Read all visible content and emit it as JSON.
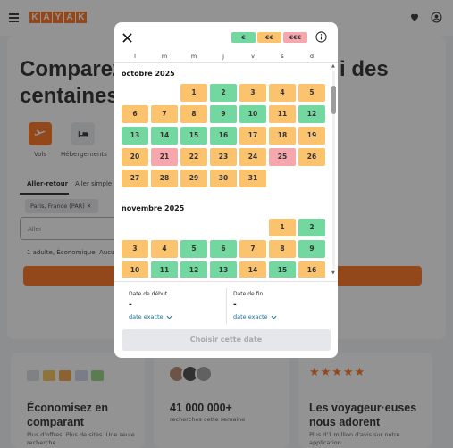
{
  "header": {
    "logo_letters": [
      "K",
      "A",
      "Y",
      "A",
      "K"
    ],
    "icons": [
      "menu-icon",
      "heart-icon",
      "user-icon"
    ]
  },
  "hero": {
    "title_line1": "Comparez",
    "title_line1_right": "i des",
    "title_line2": "centaines",
    "categories": [
      "Vols",
      "Hébergements"
    ],
    "tabs": [
      "Aller-retour",
      "Aller simple"
    ],
    "origin_chip": "Paris, France (PAR)",
    "destination_placeholder": "Aller",
    "travelers": "1 adulte, Économique, Aucu"
  },
  "cards": [
    {
      "title": "Économisez en comparant",
      "sub": "Plus d'offres. Plus de sites. Une seule recherche"
    },
    {
      "title": "41 000 000+",
      "sub": "recherches cette semaine"
    },
    {
      "title": "Les voyageur·euses nous adorent",
      "sub": "Plus d'1 million d'avis sur notre application",
      "stars": "★★★★★"
    }
  ],
  "modal": {
    "legend": {
      "low": "€",
      "mid": "€€",
      "high": "€€€"
    },
    "weekdays": [
      "l",
      "m",
      "m",
      "j",
      "v",
      "s",
      "d"
    ],
    "months": [
      {
        "title": "octobre 2025",
        "days": [
          {
            "d": "1",
            "p": "mid"
          },
          {
            "d": "2",
            "p": "low"
          },
          {
            "d": "3",
            "p": "mid"
          },
          {
            "d": "4",
            "p": "mid"
          },
          {
            "d": "5",
            "p": "mid"
          },
          {
            "d": "6",
            "p": "mid"
          },
          {
            "d": "7",
            "p": "mid"
          },
          {
            "d": "8",
            "p": "mid"
          },
          {
            "d": "9",
            "p": "low"
          },
          {
            "d": "10",
            "p": "low"
          },
          {
            "d": "11",
            "p": "mid"
          },
          {
            "d": "12",
            "p": "low"
          },
          {
            "d": "13",
            "p": "low"
          },
          {
            "d": "14",
            "p": "low"
          },
          {
            "d": "15",
            "p": "low"
          },
          {
            "d": "16",
            "p": "low"
          },
          {
            "d": "17",
            "p": "mid"
          },
          {
            "d": "18",
            "p": "mid"
          },
          {
            "d": "19",
            "p": "mid"
          },
          {
            "d": "20",
            "p": "mid"
          },
          {
            "d": "21",
            "p": "high"
          },
          {
            "d": "22",
            "p": "mid"
          },
          {
            "d": "23",
            "p": "mid"
          },
          {
            "d": "24",
            "p": "mid"
          },
          {
            "d": "25",
            "p": "high"
          },
          {
            "d": "26",
            "p": "mid"
          },
          {
            "d": "27",
            "p": "mid"
          },
          {
            "d": "28",
            "p": "mid"
          },
          {
            "d": "29",
            "p": "mid"
          },
          {
            "d": "30",
            "p": "mid"
          },
          {
            "d": "31",
            "p": "mid"
          }
        ]
      },
      {
        "title": "novembre 2025",
        "days": [
          {
            "d": "1",
            "p": "mid"
          },
          {
            "d": "2",
            "p": "low"
          },
          {
            "d": "3",
            "p": "mid"
          },
          {
            "d": "4",
            "p": "mid"
          },
          {
            "d": "5",
            "p": "low"
          },
          {
            "d": "6",
            "p": "low"
          },
          {
            "d": "7",
            "p": "mid"
          },
          {
            "d": "8",
            "p": "mid"
          },
          {
            "d": "9",
            "p": "low"
          },
          {
            "d": "10",
            "p": "mid"
          },
          {
            "d": "11",
            "p": "low"
          },
          {
            "d": "12",
            "p": "low"
          },
          {
            "d": "13",
            "p": "low"
          },
          {
            "d": "14",
            "p": "mid"
          },
          {
            "d": "15",
            "p": "low"
          },
          {
            "d": "16",
            "p": "mid"
          }
        ]
      }
    ],
    "start": {
      "label": "Date de début",
      "value": "-",
      "mode": "date exacte"
    },
    "end": {
      "label": "Date de fin",
      "value": "-",
      "mode": "date exacte"
    },
    "choose_label": "Choisir cette date"
  },
  "colors": {
    "brand": "#ff690f",
    "price_low": "#73d7a0",
    "price_mid": "#fcc36e",
    "price_high": "#f6a6ad",
    "link": "#0b6fa4"
  }
}
